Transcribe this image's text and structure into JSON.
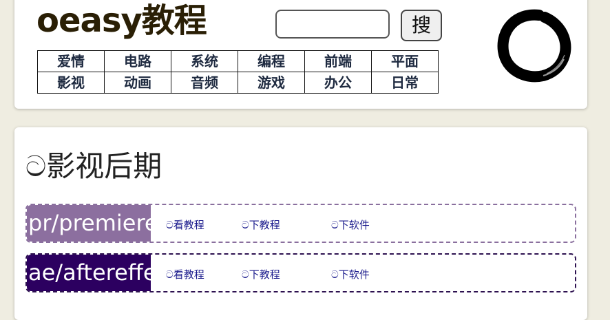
{
  "header": {
    "title": "oeasy教程",
    "search": {
      "value": "",
      "placeholder": ""
    },
    "search_button_label": "搜",
    "nav_rows": [
      [
        "爱情",
        "电路",
        "系统",
        "编程",
        "前端",
        "平面"
      ],
      [
        "影视",
        "动画",
        "音频",
        "游戏",
        "办公",
        "日常"
      ]
    ]
  },
  "content": {
    "section_title": "ට影视后期",
    "courses": [
      {
        "name": "pr/premiere",
        "color": "#8c6f9f",
        "watch_label": "ට看教程",
        "download_label": "ට下教程",
        "software_label": "ට下软件"
      },
      {
        "name": "ae/aftereffects",
        "color": "#2c0060",
        "watch_label": "ට看教程",
        "download_label": "ට下教程",
        "software_label": "ට下软件"
      }
    ]
  }
}
